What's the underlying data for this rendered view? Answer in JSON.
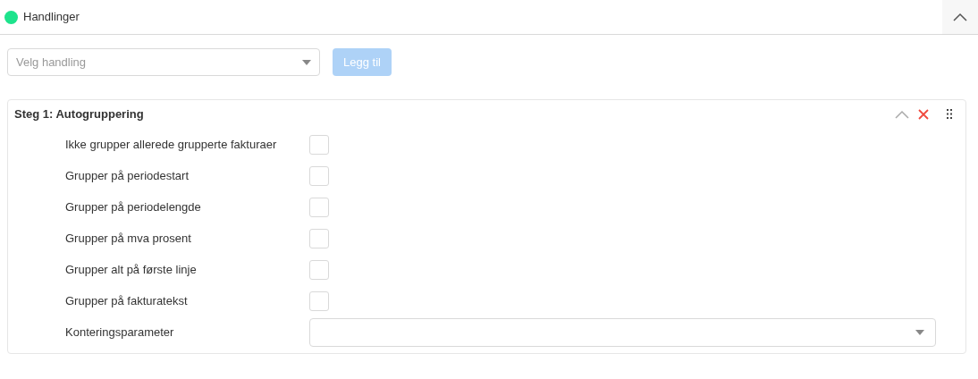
{
  "section": {
    "title": "Handlinger",
    "color": "#1de38c",
    "expanded": true
  },
  "action_select": {
    "placeholder": "Velg handling"
  },
  "add_button": {
    "label": "Legg til",
    "disabled": true
  },
  "step": {
    "title": "Steg 1: Autogruppering",
    "expanded": true,
    "rows": [
      {
        "kind": "checkbox",
        "label": "Ikke grupper allerede grupperte fakturaer",
        "checked": false
      },
      {
        "kind": "checkbox",
        "label": "Grupper på periodestart",
        "checked": false
      },
      {
        "kind": "checkbox",
        "label": "Grupper på periodelengde",
        "checked": false
      },
      {
        "kind": "checkbox",
        "label": "Grupper på mva prosent",
        "checked": false
      },
      {
        "kind": "checkbox",
        "label": "Grupper alt på første linje",
        "checked": false
      },
      {
        "kind": "checkbox",
        "label": "Grupper på fakturatekst",
        "checked": false
      },
      {
        "kind": "select",
        "label": "Konteringsparameter"
      }
    ]
  }
}
